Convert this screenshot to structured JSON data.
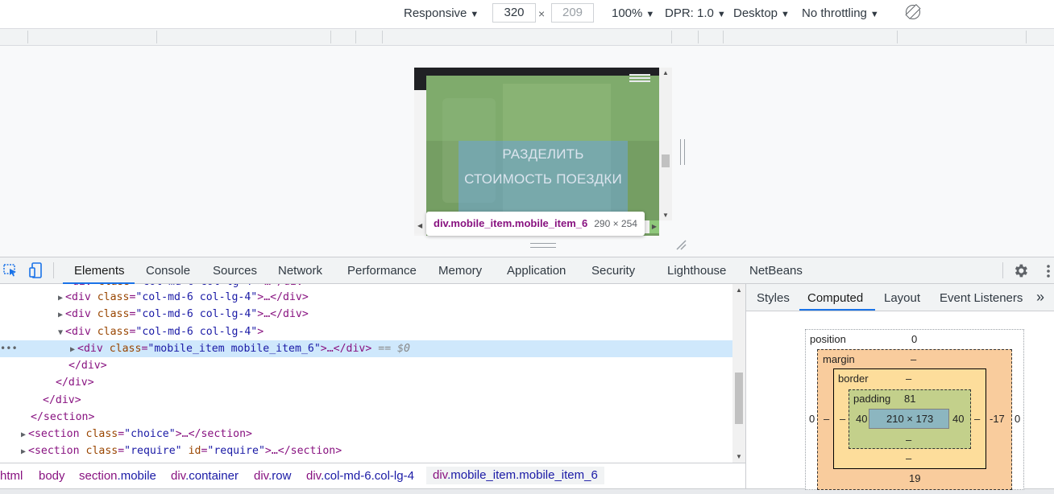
{
  "device_toolbar": {
    "device": "Responsive",
    "width": "320",
    "height": "209",
    "times": "×",
    "zoom": "100%",
    "dpr": "DPR: 1.0",
    "mode": "Desktop",
    "throttling": "No throttling",
    "caret": "▼"
  },
  "viewport": {
    "page_text_line1": "РАЗДЕЛИТЬ",
    "page_text_line2": "СТОИМОСТЬ ПОЕЗДКИ",
    "tooltip_selector": "div.mobile_item.mobile_item_6",
    "tooltip_size": "290 × 254"
  },
  "main_tabs": [
    "Elements",
    "Console",
    "Sources",
    "Network",
    "Performance",
    "Memory",
    "Application",
    "Security",
    "Lighthouse",
    "NetBeans"
  ],
  "dom": {
    "lines": [
      {
        "open": "<div ",
        "attr": "class",
        "val": "\"col-md-6 col-lg-4\"",
        "rest": ">…</div>"
      },
      {
        "open": "<div ",
        "attr": "class",
        "val": "\"col-md-6 col-lg-4\"",
        "rest": ">…</div>"
      },
      {
        "open": "<div ",
        "attr": "class",
        "val": "\"col-md-6 col-lg-4\"",
        "rest": ">"
      },
      {
        "open": "<div ",
        "attr": "class",
        "val": "\"mobile_item mobile_item_6\"",
        "rest": ">…</div>",
        "eq": "== $0"
      },
      {
        "close": "</div>"
      },
      {
        "close": "</div>"
      },
      {
        "close": "</div>"
      },
      {
        "close": "</section>"
      },
      {
        "open": "<section ",
        "attr": "class",
        "val": "\"choice\"",
        "rest": ">…</section>"
      },
      {
        "open": "<section ",
        "attr": "class",
        "val": "\"require\"",
        "attr2": "id",
        "val2": "\"require\"",
        "rest": ">…</section>"
      }
    ],
    "dots": "•••"
  },
  "breadcrumbs": [
    {
      "tag": "html",
      "cls": ""
    },
    {
      "tag": "body",
      "cls": ""
    },
    {
      "tag": "section",
      "cls": ".mobile"
    },
    {
      "tag": "div",
      "cls": ".container"
    },
    {
      "tag": "div",
      "cls": ".row"
    },
    {
      "tag": "div",
      "cls": ".col-md-6.col-lg-4"
    },
    {
      "tag": "div",
      "cls": ".mobile_item.mobile_item_6"
    }
  ],
  "side_tabs": [
    "Styles",
    "Computed",
    "Layout",
    "Event Listeners",
    "»"
  ],
  "box_model": {
    "position_label": "position",
    "position_top": "0",
    "position_left": "0",
    "position_right": "0",
    "margin_label": "margin",
    "margin_top": "–",
    "margin_left": "–",
    "margin_right": "-17",
    "margin_bottom": "19",
    "border_label": "border",
    "border_top": "–",
    "border_left": "–",
    "border_right": "–",
    "border_bottom": "–",
    "padding_label": "padding",
    "padding_top": "81",
    "padding_left": "40",
    "padding_right": "40",
    "padding_bottom": "–",
    "content_size": "210 × 173"
  }
}
